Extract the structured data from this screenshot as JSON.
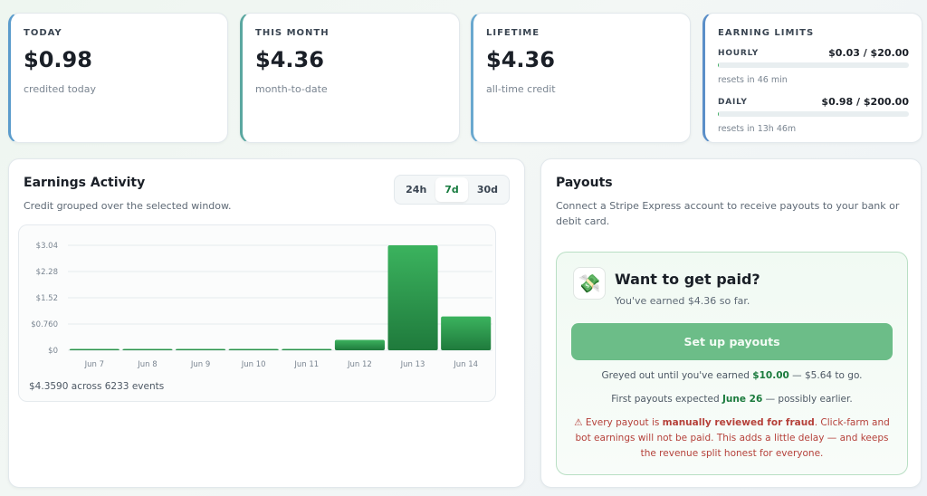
{
  "stats": [
    {
      "label": "TODAY",
      "value": "$0.98",
      "sub": "credited today"
    },
    {
      "label": "THIS MONTH",
      "value": "$4.36",
      "sub": "month-to-date"
    },
    {
      "label": "LIFETIME",
      "value": "$4.36",
      "sub": "all-time credit"
    }
  ],
  "limits": {
    "label": "EARNING LIMITS",
    "hourly": {
      "name": "HOURLY",
      "value": "$0.03 / $20.00",
      "fraction": 0.0015,
      "reset": "resets in 46 min"
    },
    "daily": {
      "name": "DAILY",
      "value": "$0.98 / $200.00",
      "fraction": 0.0049,
      "reset": "resets in 13h 46m"
    }
  },
  "activity": {
    "title": "Earnings Activity",
    "subtitle": "Credit grouped over the selected window.",
    "ranges": [
      "24h",
      "7d",
      "30d"
    ],
    "active_range": "7d",
    "summary": "$4.3590 across 6233 events"
  },
  "chart_data": {
    "type": "bar",
    "categories": [
      "Jun 7",
      "Jun 8",
      "Jun 9",
      "Jun 10",
      "Jun 11",
      "Jun 12",
      "Jun 13",
      "Jun 14"
    ],
    "values": [
      0.02,
      0.02,
      0.02,
      0.02,
      0.02,
      0.3,
      3.04,
      0.98
    ],
    "y_ticks": [
      "$0",
      "$0.760",
      "$1.52",
      "$2.28",
      "$3.04"
    ],
    "y_tick_values": [
      0,
      0.76,
      1.52,
      2.28,
      3.04
    ],
    "ylim": [
      0,
      3.04
    ],
    "grid": true,
    "colors": {
      "bar_top": "#3bb35e",
      "bar_bottom": "#1f7a3c"
    }
  },
  "payouts": {
    "title": "Payouts",
    "subtitle": "Connect a Stripe Express account to receive payouts to your bank or debit card.",
    "promo": {
      "icon": "money-with-wings-icon",
      "title": "Want to get paid?",
      "subtitle": "You've earned $4.36 so far.",
      "button": "Set up payouts",
      "greyed_prefix": "Greyed out until you've earned ",
      "greyed_amount": "$10.00",
      "greyed_suffix": " — $5.64 to go.",
      "first_prefix": "First payouts expected ",
      "first_date": "June 26",
      "first_suffix": " — possibly earlier.",
      "warn_prefix": "⚠ Every payout is ",
      "warn_bold": "manually reviewed for fraud",
      "warn_suffix": ". Click-farm and bot earnings will not be paid. This adds a little delay — and keeps the revenue split honest for everyone."
    }
  }
}
